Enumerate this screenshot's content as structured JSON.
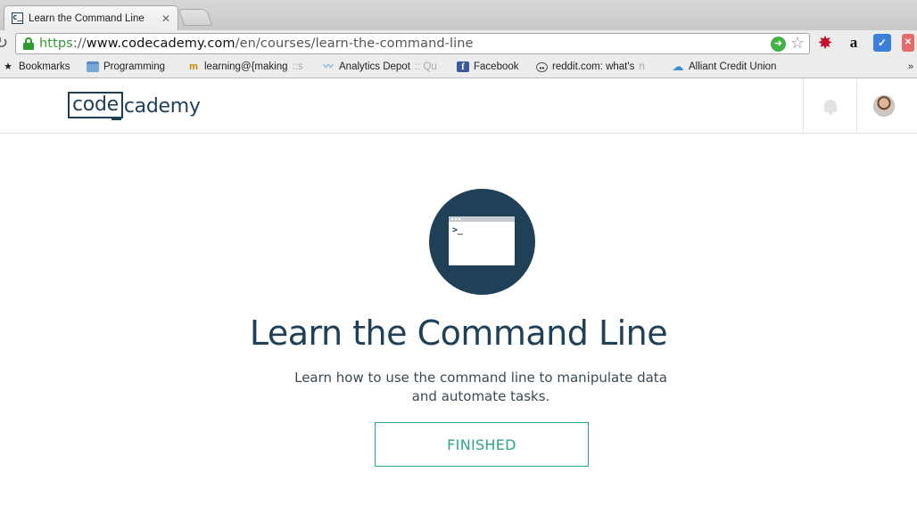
{
  "browser": {
    "tab": {
      "title": "Learn the Command Line",
      "favicon": "c_"
    },
    "url": {
      "scheme": "https",
      "separator": "://",
      "host": "www.codecademy.com",
      "path": "/en/courses/learn-the-command-line"
    },
    "bookmarks_bar": [
      {
        "label": "Bookmarks",
        "icon": "star-icon"
      },
      {
        "label": "Programming",
        "icon": "folder-icon"
      },
      {
        "label": "learning@{making",
        "icon": "m-icon",
        "faded_suffix": "::s"
      },
      {
        "label": "Analytics Depot",
        "icon": "chart-icon",
        "faded_suffix": ":: Qu"
      },
      {
        "label": "Facebook",
        "icon": "facebook-icon"
      },
      {
        "label": "reddit.com: what's",
        "icon": "reddit-icon",
        "faded_suffix": "n"
      },
      {
        "label": "Alliant Credit Union",
        "icon": "alliant-icon"
      }
    ],
    "bookmarks_more": "»",
    "extensions": [
      "burst-icon",
      "amazon-icon",
      "check-icon",
      "lastpass-icon"
    ],
    "extension_text": {
      "amazon": "a",
      "check": "✓",
      "red": "✕"
    }
  },
  "site": {
    "logo": {
      "boxed": "code",
      "rest": "cademy"
    },
    "header_icons": [
      "bell-icon",
      "avatar"
    ]
  },
  "course": {
    "prompt": ">_",
    "title": "Learn the Command Line",
    "description": "Learn how to use the command line to manipulate data and automate tasks.",
    "status_button": "FINISHED"
  },
  "colors": {
    "brand_navy": "#204057",
    "finished_teal": "#2ba58e",
    "secure_green": "#2d9b2d"
  }
}
